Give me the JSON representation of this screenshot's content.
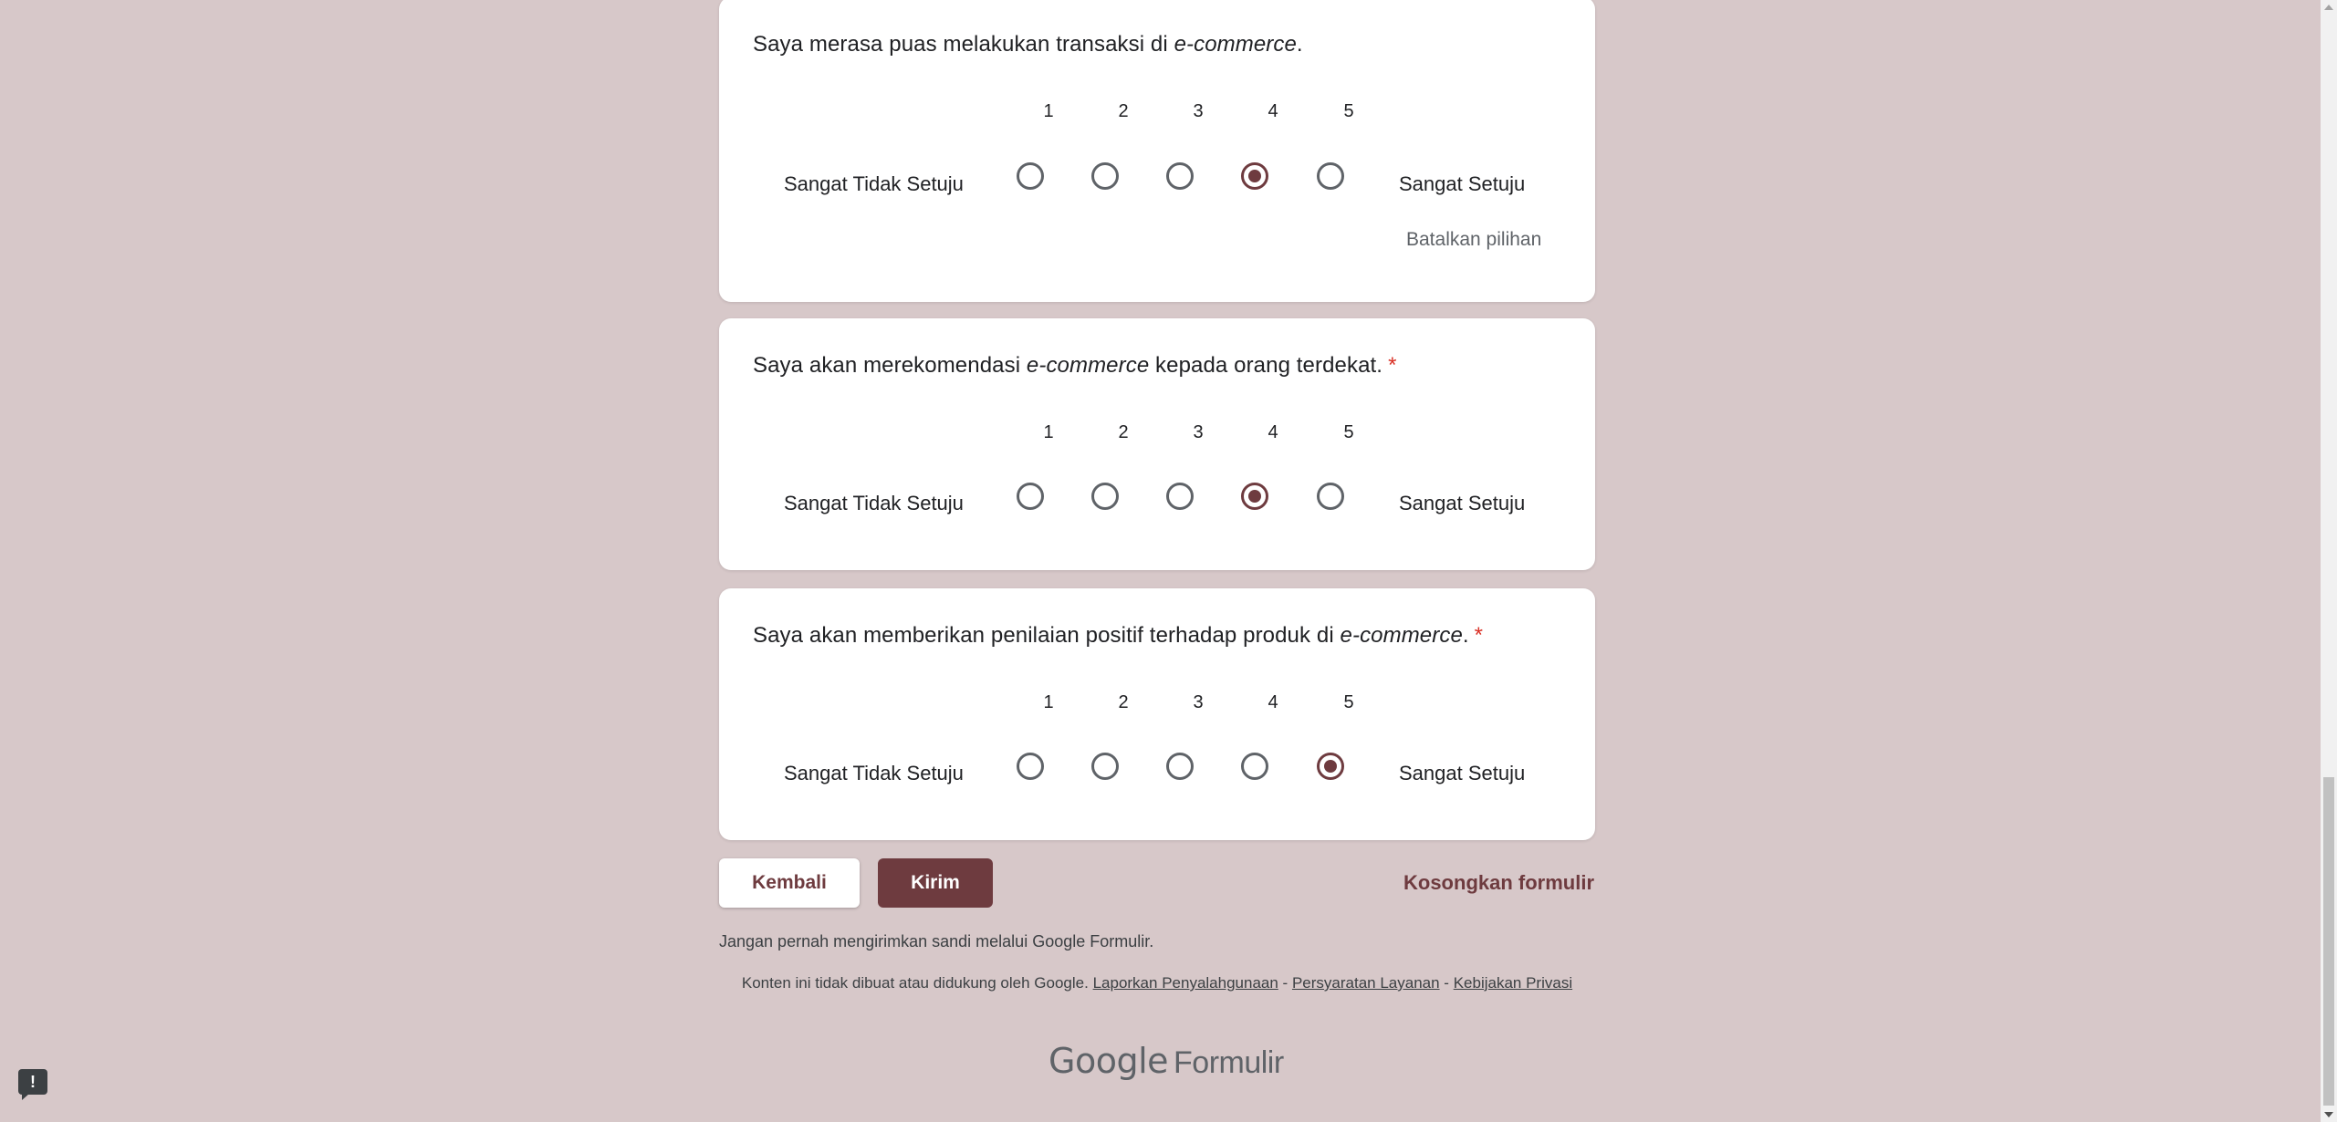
{
  "questions": [
    {
      "title_pre": "Saya merasa puas melakukan transaksi di ",
      "title_em": "e-commerce",
      "title_post": ".",
      "required": "",
      "scale": [
        "1",
        "2",
        "3",
        "4",
        "5"
      ],
      "low_label": "Sangat Tidak Setuju",
      "high_label": "Sangat Setuju",
      "selected": 4,
      "clear_label": "Batalkan pilihan"
    },
    {
      "title_pre": "Saya akan merekomendasi ",
      "title_em": "e-commerce",
      "title_post": " kepada orang terdekat.",
      "required": "*",
      "scale": [
        "1",
        "2",
        "3",
        "4",
        "5"
      ],
      "low_label": "Sangat Tidak Setuju",
      "high_label": "Sangat Setuju",
      "selected": 4
    },
    {
      "title_pre": "Saya akan memberikan penilaian positif terhadap produk di ",
      "title_em": "e-commerce",
      "title_post": ".",
      "required": "*",
      "scale": [
        "1",
        "2",
        "3",
        "4",
        "5"
      ],
      "low_label": "Sangat Tidak Setuju",
      "high_label": "Sangat Setuju",
      "selected": 5
    }
  ],
  "actions": {
    "back_label": "Kembali",
    "submit_label": "Kirim",
    "clear_form_label": "Kosongkan formulir"
  },
  "footer": {
    "password_note": "Jangan pernah mengirimkan sandi melalui Google Formulir.",
    "disclaimer": "Konten ini tidak dibuat atau didukung oleh Google.",
    "report_link": "Laporkan Penyalahgunaan",
    "separator": "-",
    "terms_link": "Persyaratan Layanan",
    "privacy_link": "Kebijakan Privasi",
    "logo_google": "Google",
    "logo_forms": "Formulir"
  },
  "feedback_icon": "!",
  "colors": {
    "background": "#d7c8c9",
    "accent": "#6e3b3f",
    "required": "#d93025"
  }
}
